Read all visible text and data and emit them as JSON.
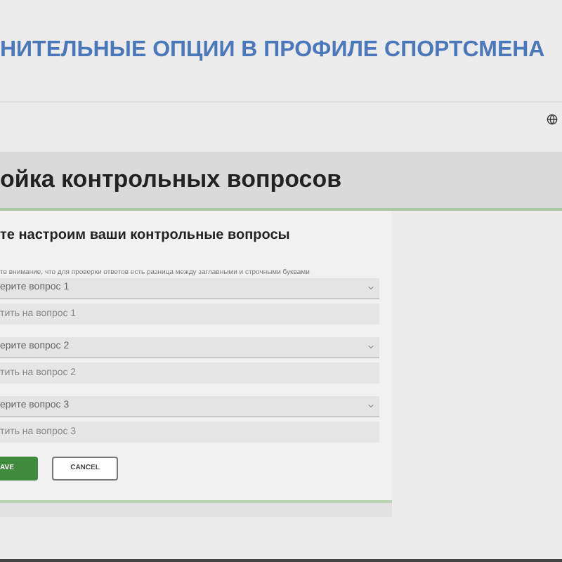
{
  "slide_title": "НИТЕЛЬНЫЕ ОПЦИИ В ПРОФИЛЕ СПОРТСМЕНА",
  "page": {
    "heading": "ойка контрольных вопросов",
    "subtitle": "те настроим ваши контрольные вопросы",
    "note": "те внимание, что для проверки ответов есть разница между заглавными и строчными буквами",
    "questions": [
      {
        "select": "ерите вопрос 1",
        "answer_placeholder": "тить на вопрос 1"
      },
      {
        "select": "ерите вопрос 2",
        "answer_placeholder": "тить на вопрос 2"
      },
      {
        "select": "ерите вопрос 3",
        "answer_placeholder": "тить на вопрос 3"
      }
    ],
    "buttons": [
      {
        "kind": "primary",
        "label": "AVE"
      },
      {
        "kind": "secondary",
        "label": "CANCEL"
      }
    ]
  }
}
